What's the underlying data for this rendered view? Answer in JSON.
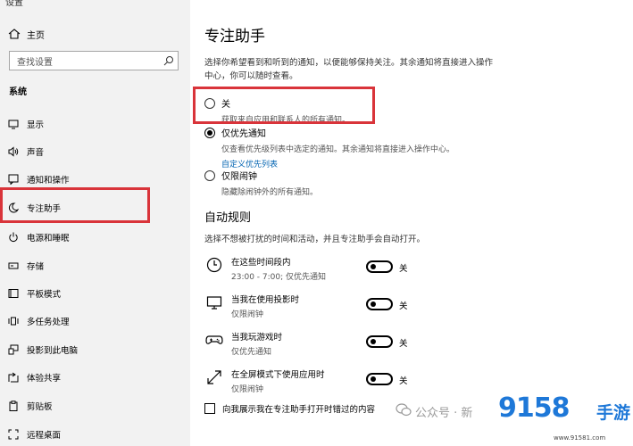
{
  "window": {
    "title": "设置"
  },
  "sidebar": {
    "home_label": "主页",
    "search_placeholder": "查找设置",
    "section": "系统",
    "items": [
      {
        "label": "显示",
        "icon": "display-icon"
      },
      {
        "label": "声音",
        "icon": "speaker-icon"
      },
      {
        "label": "通知和操作",
        "icon": "notification-icon"
      },
      {
        "label": "专注助手",
        "icon": "moon-icon",
        "selected": true
      },
      {
        "label": "电源和睡眠",
        "icon": "power-icon"
      },
      {
        "label": "存储",
        "icon": "storage-icon"
      },
      {
        "label": "平板模式",
        "icon": "tablet-icon"
      },
      {
        "label": "多任务处理",
        "icon": "multitask-icon"
      },
      {
        "label": "投影到此电脑",
        "icon": "project-icon"
      },
      {
        "label": "体验共享",
        "icon": "share-icon"
      },
      {
        "label": "剪贴板",
        "icon": "clipboard-icon"
      },
      {
        "label": "远程桌面",
        "icon": "remote-icon"
      }
    ]
  },
  "main": {
    "title": "专注助手",
    "description": "选择你希望看到和听到的通知，以便能够保持关注。其余通知将直接进入操作中心，你可以随时查看。",
    "options": [
      {
        "label": "关",
        "sub": "获取来自应用和联系人的所有通知。",
        "checked": false
      },
      {
        "label": "仅优先通知",
        "sub": "仅查看优先级列表中选定的通知。其余通知将直接进入操作中心。",
        "link": "自定义优先列表",
        "checked": true
      },
      {
        "label": "仅限闹钟",
        "sub": "隐藏除闹钟外的所有通知。",
        "checked": false
      }
    ],
    "rules_title": "自动规则",
    "rules_desc": "选择不想被打扰的时间和活动，并且专注助手会自动打开。",
    "rules": [
      {
        "title": "在这些时间段内",
        "sub": "23:00 - 7:00; 仅优先通知",
        "icon": "clock-icon",
        "state": "关"
      },
      {
        "title": "当我在使用投影时",
        "sub": "仅限闹钟",
        "icon": "monitor-icon",
        "state": "关"
      },
      {
        "title": "当我玩游戏时",
        "sub": "仅优先通知",
        "icon": "gamepad-icon",
        "state": "关"
      },
      {
        "title": "在全屏模式下使用应用时",
        "sub": "仅限闹钟",
        "icon": "fullscreen-icon",
        "state": "关"
      }
    ],
    "checkbox_label": "向我展示我在专注助手打开时错过的内容"
  },
  "overlay": {
    "wechat_label": "公众号 · 新",
    "brand_logo": "9158",
    "brand_logo2": "手游",
    "brand_url": "www.91581.com"
  },
  "colors": {
    "highlight": "#d9343a",
    "link": "#0063b1",
    "brand": "#1e78d8"
  }
}
